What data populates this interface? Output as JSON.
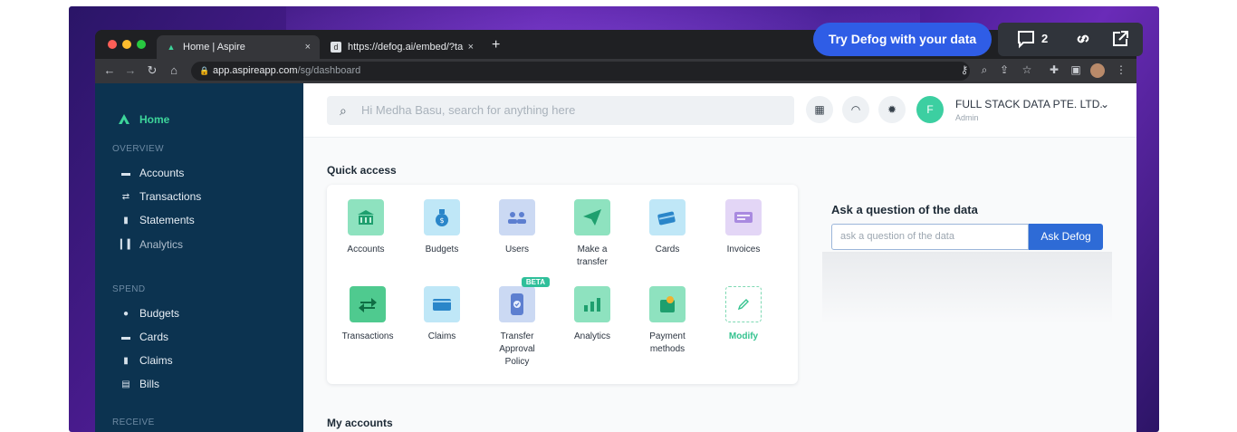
{
  "browser": {
    "tabs": [
      {
        "label": "Home | Aspire",
        "active": true
      },
      {
        "label": "https://defog.ai/embed/?table=",
        "active": false
      }
    ],
    "new_tab": "+",
    "close_glyph": "×",
    "url_host": "app.aspireapp.com",
    "url_path": "/sg/dashboard"
  },
  "sidebar": {
    "home_label": "Home",
    "sections": {
      "overview": "OVERVIEW",
      "spend": "SPEND",
      "receive": "RECEIVE"
    },
    "overview_items": [
      {
        "label": "Accounts",
        "icon": "wallet-icon"
      },
      {
        "label": "Transactions",
        "icon": "transfer-icon"
      },
      {
        "label": "Statements",
        "icon": "document-icon"
      },
      {
        "label": "Analytics",
        "icon": "bar-chart-icon"
      }
    ],
    "spend_items": [
      {
        "label": "Budgets",
        "icon": "money-bag-icon"
      },
      {
        "label": "Cards",
        "icon": "card-icon"
      },
      {
        "label": "Claims",
        "icon": "receipt-icon"
      },
      {
        "label": "Bills",
        "icon": "bill-icon"
      }
    ]
  },
  "header": {
    "search_placeholder": "Hi Medha Basu, search for anything here",
    "company": "FULL STACK DATA PTE. LTD.",
    "role": "Admin",
    "avatar_initial": "F"
  },
  "quick_access": {
    "title": "Quick access",
    "tiles": [
      {
        "label": "Accounts",
        "icon": "bank-icon"
      },
      {
        "label": "Budgets",
        "icon": "money-bag-icon"
      },
      {
        "label": "Users",
        "icon": "users-icon"
      },
      {
        "label": "Make a transfer",
        "icon": "paper-plane-icon"
      },
      {
        "label": "Cards",
        "icon": "card-icon"
      },
      {
        "label": "Invoices",
        "icon": "invoice-icon"
      },
      {
        "label": "Transactions",
        "icon": "transfer-arrows-icon"
      },
      {
        "label": "Claims",
        "icon": "wallet-icon"
      },
      {
        "label": "Transfer Approval Policy",
        "icon": "phone-check-icon",
        "badge": "BETA"
      },
      {
        "label": "Analytics",
        "icon": "bar-chart-icon"
      },
      {
        "label": "Payment methods",
        "icon": "payment-icon"
      },
      {
        "label": "Modify",
        "icon": "pencil-icon"
      }
    ]
  },
  "ask_panel": {
    "title": "Ask a question of the data",
    "input_placeholder": "ask a question of the data",
    "button_label": "Ask Defog"
  },
  "my_accounts": {
    "title": "My accounts"
  },
  "defog_overlay": {
    "cta_label": "Try Defog with your data",
    "comment_count": "2"
  },
  "colors": {
    "sidebar_bg": "#0c3350",
    "accent_green": "#3dd59a",
    "defog_blue": "#2f5de6",
    "ask_button_blue": "#2e6bd6"
  }
}
